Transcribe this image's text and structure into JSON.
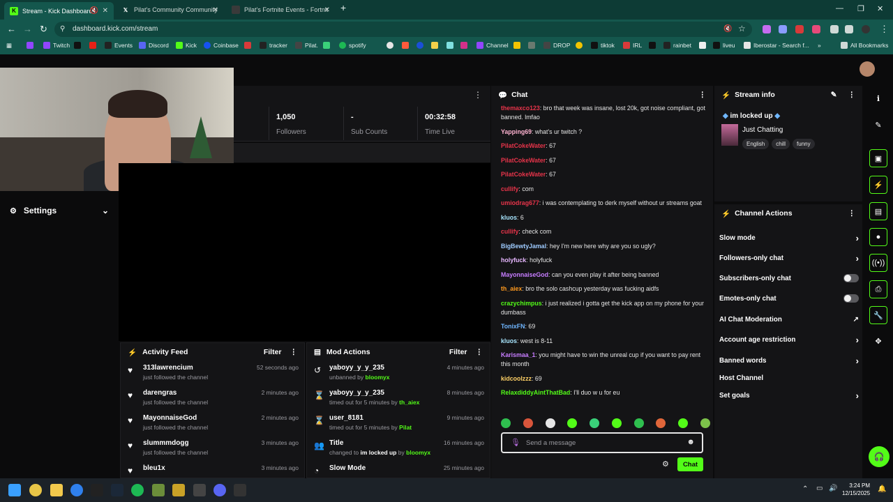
{
  "browser": {
    "tabs": [
      {
        "title": "Stream - Kick Dashboard",
        "active": true
      },
      {
        "title": "Pilat's Community Community",
        "active": false
      },
      {
        "title": "Pilat’s Fortnite Events - Fortnit",
        "active": false
      }
    ],
    "url": "dashboard.kick.com/stream",
    "bookmarks": [
      "Twitch",
      "Events",
      "Discord",
      "Kick",
      "Coinbase",
      "tracker",
      "Pilat.",
      "spotify",
      "Channel",
      "DROP",
      "tiktok",
      "IRL",
      "rainbet",
      "liveu",
      "Iberostar - Search f...",
      "All Bookmarks"
    ]
  },
  "stats": [
    {
      "value": "1,050",
      "label": "Followers"
    },
    {
      "value": "-",
      "label": "Sub Counts"
    },
    {
      "value": "00:32:58",
      "label": "Time Live"
    }
  ],
  "settings_label": "Settings",
  "activity_feed": {
    "title": "Activity Feed",
    "filter": "Filter",
    "items": [
      {
        "name": "313lawrencium",
        "sub": "just followed the channel",
        "time": "52 seconds ago"
      },
      {
        "name": "darengras",
        "sub": "just followed the channel",
        "time": "2 minutes ago"
      },
      {
        "name": "MayonnaiseGod",
        "sub": "just followed the channel",
        "time": "2 minutes ago"
      },
      {
        "name": "slummmdogg",
        "sub": "just followed the channel",
        "time": "3 minutes ago"
      },
      {
        "name": "bleu1x",
        "sub": "",
        "time": "3 minutes ago"
      }
    ]
  },
  "mod_actions": {
    "title": "Mod Actions",
    "filter": "Filter",
    "items": [
      {
        "name": "yaboyy_y_y_235",
        "sub": "unbanned by",
        "by": "bloomyx",
        "time": "4 minutes ago"
      },
      {
        "name": "yaboyy_y_y_235",
        "sub": "timed out for 5 minutes by",
        "by": "th_aiex",
        "time": "8 minutes ago"
      },
      {
        "name": "user_8181",
        "sub": "timed out for 5 minutes by",
        "by": "Pilat",
        "time": "9 minutes ago"
      },
      {
        "name": "Title",
        "sub": "changed to",
        "title_value": "im locked up",
        "by_prefix": "by",
        "by": "bloomyx",
        "time": "16 minutes ago"
      },
      {
        "name": "Slow Mode",
        "sub": "",
        "by": "",
        "time": "25 minutes ago"
      }
    ]
  },
  "chat": {
    "title": "Chat",
    "placeholder": "Send a message",
    "send_label": "Chat",
    "messages": [
      {
        "user": "themaxco123",
        "color": "#e8344a",
        "text": "bro that week was insane, lost 20k, got noise compliant, got banned. lmfao"
      },
      {
        "user": "Yapping69",
        "color": "#ffb3d1",
        "text": "what's ur twitch ?"
      },
      {
        "user": "PilatCokeWater",
        "color": "#e8344a",
        "text": "67"
      },
      {
        "user": "PilatCokeWater",
        "color": "#e8344a",
        "text": "67"
      },
      {
        "user": "PilatCokeWater",
        "color": "#e8344a",
        "text": "67"
      },
      {
        "user": "cullify",
        "color": "#e8344a",
        "text": "com"
      },
      {
        "user": "umiodrag677",
        "color": "#e8344a",
        "text": "i was contemplating to derk myself without ur streams goat"
      },
      {
        "user": "kluos",
        "color": "#a8e6ff",
        "text": "6"
      },
      {
        "user": "cullify",
        "color": "#e8344a",
        "text": "check com"
      },
      {
        "user": "BigBewtyJamal",
        "color": "#9ecbff",
        "text": "hey I'm new here why are you so ugly?"
      },
      {
        "user": "holyfuck",
        "color": "#e7b7ff",
        "text": "holyfuck"
      },
      {
        "user": "MayonnaiseGod",
        "color": "#c77dff",
        "text": "can you even play it after being banned"
      },
      {
        "user": "th_aiex",
        "color": "#ff9a1f",
        "text": "bro the solo cashcup yesterday was fucking aidfs"
      },
      {
        "user": "crazychimpus",
        "color": "#53fc18",
        "text": "i just realized i gotta get the kick app on my phone for your dumbass"
      },
      {
        "user": "TonixFN",
        "color": "#6fb6ff",
        "text": "69"
      },
      {
        "user": "kluos",
        "color": "#a8e6ff",
        "text": "west is 8-11"
      },
      {
        "user": "Karismaa_1",
        "color": "#c77dff",
        "text": "you might have to win the unreal cup if you want to pay rent this month"
      },
      {
        "user": "kidcoolzzz",
        "color": "#ffd166",
        "text": "69"
      },
      {
        "user": "RelaxdiddyAintThatBad",
        "color": "#53fc18",
        "text": "I'll duo w u for eu"
      }
    ]
  },
  "stream_info": {
    "title": "Stream info",
    "stream_title": "im locked up",
    "category": "Just Chatting",
    "tags": [
      "English",
      "chill",
      "funny"
    ]
  },
  "channel_actions": {
    "title": "Channel Actions",
    "items": [
      {
        "label": "Slow mode",
        "kind": "chevron"
      },
      {
        "label": "Followers-only chat",
        "kind": "chevron"
      },
      {
        "label": "Subscribers-only chat",
        "kind": "toggle"
      },
      {
        "label": "Emotes-only chat",
        "kind": "toggle"
      },
      {
        "label": "AI Chat Moderation",
        "kind": "external"
      },
      {
        "label": "Account age restriction",
        "kind": "chevron"
      },
      {
        "label": "Banned words",
        "kind": "chevron"
      },
      {
        "label": "Host Channel",
        "kind": "none"
      },
      {
        "label": "Set goals",
        "kind": "chevron"
      }
    ]
  },
  "taskbar": {
    "time": "3:24 PM",
    "date": "12/15/2025"
  },
  "colors": {
    "accent": "#53fc18",
    "chrome": "#14574d",
    "panel": "#141416"
  }
}
